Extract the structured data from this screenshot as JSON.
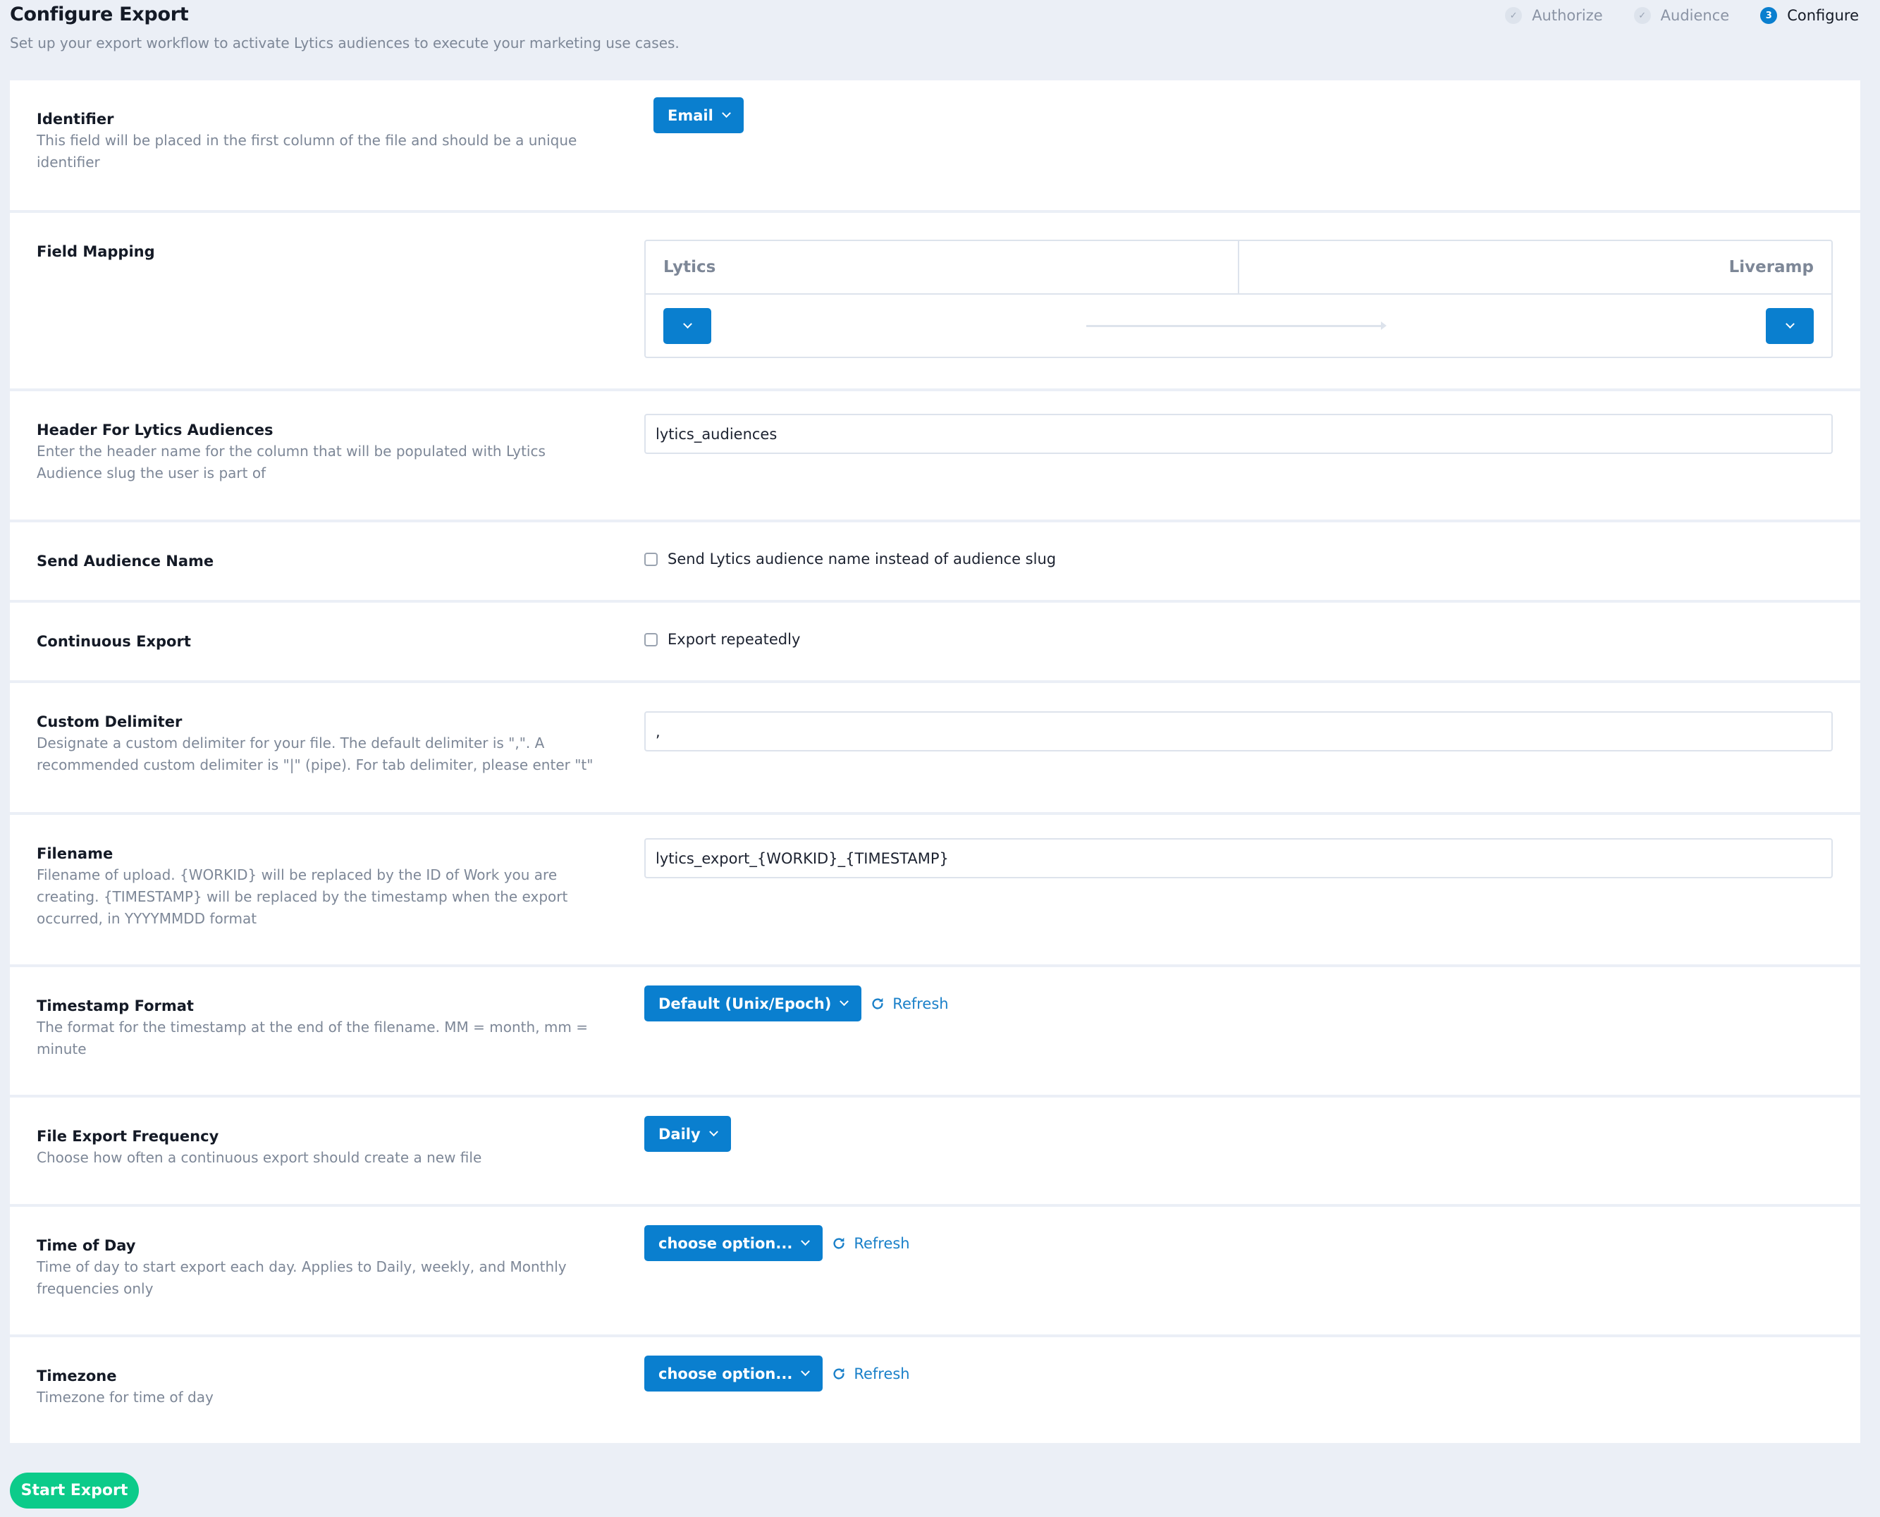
{
  "header": {
    "title": "Configure Export",
    "subtitle": "Set up your export workflow to activate Lytics audiences to execute your marketing use cases."
  },
  "steps": [
    {
      "label": "Authorize",
      "marker": "✓",
      "state": "done"
    },
    {
      "label": "Audience",
      "marker": "✓",
      "state": "done"
    },
    {
      "label": "Configure",
      "marker": "3",
      "state": "active"
    }
  ],
  "sections": {
    "identifier": {
      "title": "Identifier",
      "description": "This field will be placed in the first column of the file and should be a unique identifier",
      "dropdown_value": "Email"
    },
    "field_mapping": {
      "title": "Field Mapping",
      "left_header": "Lytics",
      "right_header": "Liveramp"
    },
    "header_audiences": {
      "title": "Header For Lytics Audiences",
      "description": "Enter the header name for the column that will be populated with Lytics Audience slug the user is part of",
      "value": "lytics_audiences"
    },
    "send_audience_name": {
      "title": "Send Audience Name",
      "checkbox_label": "Send Lytics audience name instead of audience slug",
      "checked": false
    },
    "continuous_export": {
      "title": "Continuous Export",
      "checkbox_label": "Export repeatedly",
      "checked": false
    },
    "custom_delimiter": {
      "title": "Custom Delimiter",
      "description": "Designate a custom delimiter for your file. The default delimiter is \",\". A recommended custom delimiter is \"|\" (pipe). For tab delimiter, please enter \"t\"",
      "value": ","
    },
    "filename": {
      "title": "Filename",
      "description": "Filename of upload. {WORKID} will be replaced by the ID of Work you are creating. {TIMESTAMP} will be replaced by the timestamp when the export occurred, in YYYYMMDD format",
      "value": "lytics_export_{WORKID}_{TIMESTAMP}"
    },
    "timestamp_format": {
      "title": "Timestamp Format",
      "description": "The format for the timestamp at the end of the filename. MM = month, mm = minute",
      "dropdown_value": "Default (Unix/Epoch)",
      "refresh_label": "Refresh"
    },
    "file_export_frequency": {
      "title": "File Export Frequency",
      "description": "Choose how often a continuous export should create a new file",
      "dropdown_value": "Daily"
    },
    "time_of_day": {
      "title": "Time of Day",
      "description": "Time of day to start export each day. Applies to Daily, weekly, and Monthly frequencies only",
      "dropdown_value": "choose option...",
      "refresh_label": "Refresh"
    },
    "timezone": {
      "title": "Timezone",
      "description": "Timezone for time of day",
      "dropdown_value": "choose option...",
      "refresh_label": "Refresh"
    }
  },
  "footer": {
    "start_label": "Start Export"
  },
  "colors": {
    "primary": "#0a7fcf",
    "success": "#0ccb8a",
    "background": "#ebeff6"
  }
}
